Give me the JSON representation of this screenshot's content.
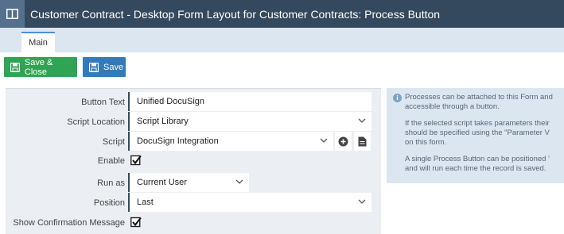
{
  "window": {
    "title": "Customer Contract - Desktop Form Layout for Customer Contracts: Process Button"
  },
  "tabs": [
    {
      "label": "Main"
    }
  ],
  "toolbar": {
    "save_close_label": "Save & Close",
    "save_label": "Save"
  },
  "form": {
    "button_text": {
      "label": "Button Text",
      "value": "Unified DocuSign"
    },
    "script_location": {
      "label": "Script Location",
      "value": "Script Library"
    },
    "script": {
      "label": "Script",
      "value": "DocuSign Integration"
    },
    "enable": {
      "label": "Enable",
      "checked": true
    },
    "run_as": {
      "label": "Run as",
      "value": "Current User"
    },
    "position": {
      "label": "Position",
      "value": "Last"
    },
    "show_confirmation": {
      "label": "Show Confirmation Message",
      "checked": true
    }
  },
  "info": {
    "paragraphs": [
      [
        "Processes can be attached to this Form and",
        "accessible through a button."
      ],
      [
        "If the selected script takes parameters their",
        "should be specified using the \"Parameter V",
        "on this form."
      ],
      [
        "A single Process Button can be positioned '",
        "and will run each time the record is saved."
      ]
    ]
  },
  "colors": {
    "titlebar": "#35495e",
    "save_close": "#31a354",
    "save": "#337ab7",
    "panel": "#ebeef2",
    "info_panel": "#dce6f0"
  }
}
